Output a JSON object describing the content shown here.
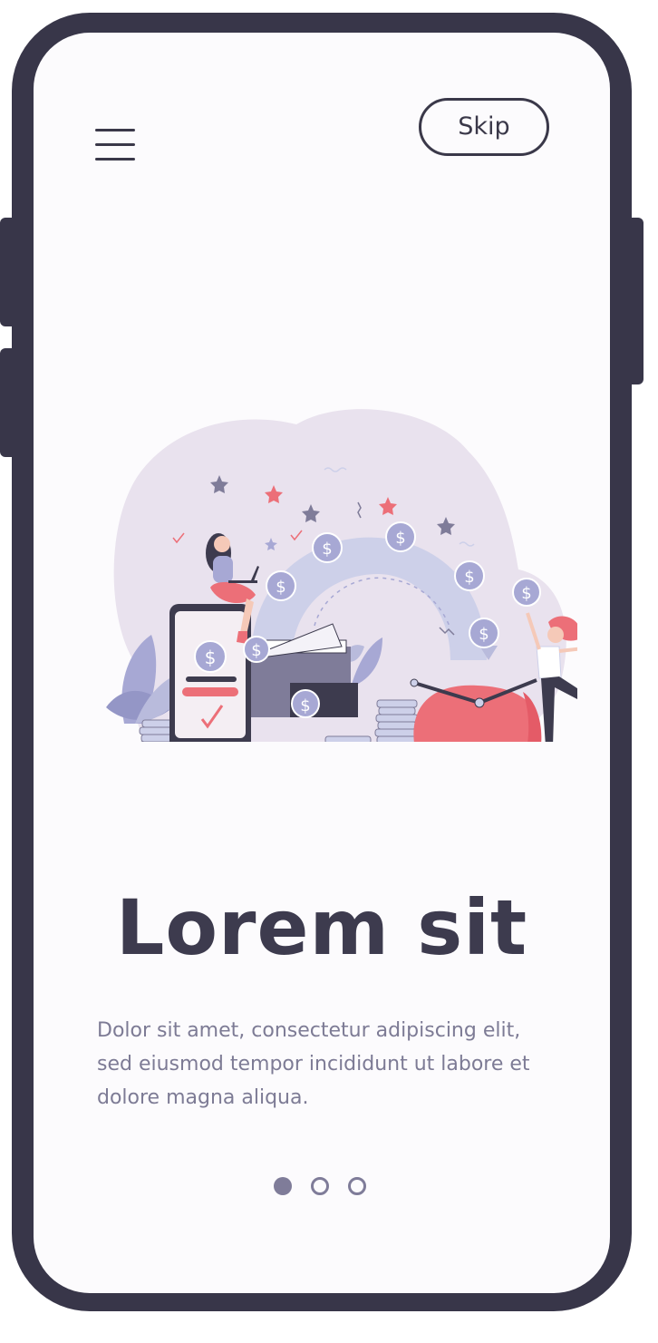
{
  "header": {
    "menu_icon": "hamburger-menu-icon",
    "skip_label": "Skip"
  },
  "hero": {
    "title": "Lorem sit",
    "description": "Dolor sit amet, consectetur adipiscing elit, sed eiusmod tempor incididunt ut labore et dolore magna aliqua.",
    "illustration": {
      "coin_symbol": "$"
    }
  },
  "pagination": {
    "total": 3,
    "active_index": 0
  },
  "colors": {
    "frame": "#383649",
    "screen": "#fcfbfd",
    "text_dark": "#3d3b4e",
    "text_muted": "#7d7b95",
    "accent_pink": "#ec6f78",
    "lavender": "#e9e2ee",
    "periwinkle": "#a7a8d4"
  }
}
